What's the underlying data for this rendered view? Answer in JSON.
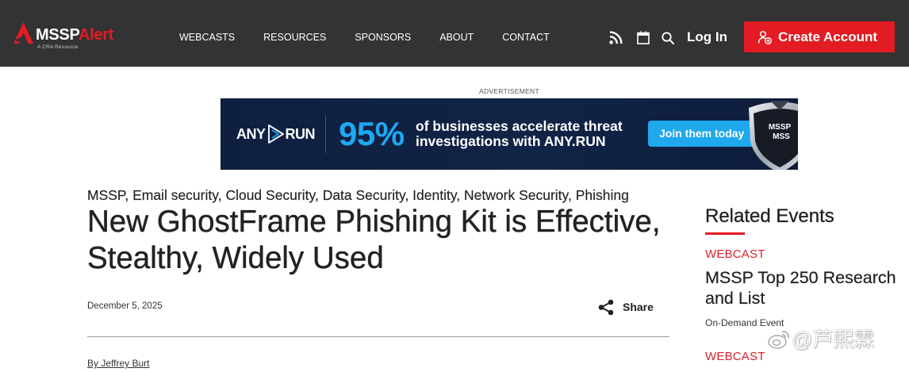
{
  "header": {
    "logo": {
      "brand_main": "MSSP",
      "brand_accent": "Alert",
      "tagline": "A CRA Resource"
    },
    "nav": [
      "WEBCASTS",
      "RESOURCES",
      "SPONSORS",
      "ABOUT",
      "CONTACT"
    ],
    "login_label": "Log In",
    "create_account_label": "Create Account"
  },
  "icons": {
    "logo_mark": "mssp-alert-logo-icon",
    "rss": "rss-icon",
    "calendar": "calendar-icon",
    "search": "search-icon",
    "user_plus": "user-plus-icon",
    "ad_play": "play-icon",
    "ad_shield": "shield-badge-icon",
    "share": "share-icon",
    "watermark": "weibo-icon"
  },
  "ad": {
    "label": "ADVERTISEMENT",
    "brand_left": "ANY",
    "brand_right": "RUN",
    "stat": "95%",
    "headline_line1": "of businesses accelerate threat",
    "headline_line2": "investigations with ANY.RUN",
    "cta": "Join them today",
    "badge_line1": "MSSP",
    "badge_line2": "MSS"
  },
  "article": {
    "categories": [
      "MSSP",
      "Email security",
      "Cloud Security",
      "Data Security",
      "Identity",
      "Network Security",
      "Phishing"
    ],
    "category_separator": ", ",
    "title": "New GhostFrame Phishing Kit is Effective, Stealthy, Widely Used",
    "date": "December 5, 2025",
    "share_label": "Share",
    "byline": "By Jeffrey Burt"
  },
  "sidebar": {
    "heading": "Related Events",
    "events": [
      {
        "type": "WEBCAST",
        "title": "MSSP Top 250 Research and List",
        "meta": "On-Demand Event"
      },
      {
        "type": "WEBCAST"
      }
    ]
  },
  "watermark": {
    "text": "@芦熙霖"
  },
  "colors": {
    "header_bg": "#333333",
    "accent_red": "#e31b23",
    "webcast_red": "#d9232b",
    "ad_background": "#0f1f3f",
    "ad_accent_blue": "#1fa8f3",
    "text_dark": "#222222"
  }
}
